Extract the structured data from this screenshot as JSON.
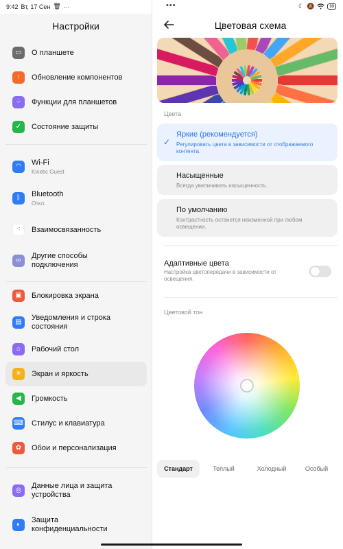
{
  "status_bar": {
    "time": "9:42",
    "date": "Вт, 17 Сен",
    "battery": "99"
  },
  "left": {
    "title": "Настройки",
    "group1": [
      {
        "label": "О планшете",
        "icon": "tablet-icon",
        "color": "#6b6b6b"
      },
      {
        "label": "Обновление компонентов",
        "icon": "update-arrow-icon",
        "color": "#f26b2b"
      },
      {
        "label": "Функции для планшетов",
        "icon": "grid-dots-icon",
        "color": "#8a6cf0"
      },
      {
        "label": "Состояние защиты",
        "icon": "shield-check-icon",
        "color": "#27b64a"
      }
    ],
    "group2": [
      {
        "label": "Wi-Fi",
        "sub": "Kinetic Guest",
        "icon": "wifi-icon",
        "color": "#2f7cf6"
      },
      {
        "label": "Bluetooth",
        "sub": "Откл.",
        "icon": "bluetooth-icon",
        "color": "#2f7cf6"
      },
      {
        "label": "Взаимосвязанность",
        "icon": "interconnect-dots-icon",
        "color": "#ffffff"
      },
      {
        "label": "Другие способы подключения",
        "icon": "link-icon",
        "color": "#8b8fd6"
      }
    ],
    "group3": [
      {
        "label": "Блокировка экрана",
        "icon": "lock-icon",
        "color": "#f0583a"
      },
      {
        "label": "Уведомления и строка состояния",
        "icon": "notification-icon",
        "color": "#2f7cf6"
      },
      {
        "label": "Рабочий стол",
        "icon": "home-icon",
        "color": "#8a6cf0"
      },
      {
        "label": "Экран и яркость",
        "icon": "sun-icon",
        "color": "#f5b11b"
      },
      {
        "label": "Громкость",
        "icon": "volume-icon",
        "color": "#27b64a"
      },
      {
        "label": "Стилус и клавиатура",
        "icon": "keyboard-icon",
        "color": "#2f7cf6"
      },
      {
        "label": "Обои и персонализация",
        "icon": "palette-icon",
        "color": "#f0583a"
      }
    ],
    "group4": [
      {
        "label": "Данные лица и защита устройства",
        "icon": "face-id-icon",
        "color": "#8a6cf0"
      },
      {
        "label": "Защита конфиденциальности",
        "icon": "privacy-icon",
        "color": "#2f7cf6"
      }
    ]
  },
  "right": {
    "title": "Цветовая схема",
    "section_colors": "Цвета",
    "options": [
      {
        "title": "Яркие (рекомендуется)",
        "desc": "Регулировать цвета в зависимости от отображаемого контента.",
        "selected": true
      },
      {
        "title": "Насыщенные",
        "desc": "Всегда увеличивать насыщенность.",
        "selected": false
      },
      {
        "title": "По умолчанию",
        "desc": "Контрастность останется неизменной при любом освещении.",
        "selected": false
      }
    ],
    "adaptive": {
      "title": "Адаптивные цвета",
      "desc": "Настройка цветопередачи в зависимости от освещения.",
      "enabled": false
    },
    "section_tone": "Цветовой тон",
    "tone_tabs": [
      "Стандарт",
      "Теплый",
      "Холодный",
      "Особый"
    ],
    "accent": "#2a72e3"
  }
}
